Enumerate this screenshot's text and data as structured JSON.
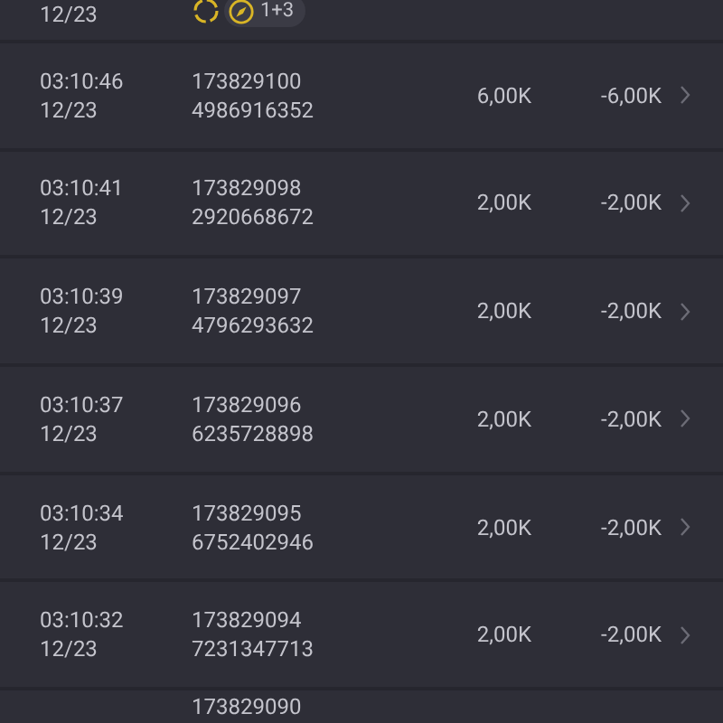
{
  "rows": [
    {
      "kind": "tail",
      "date": "12/23",
      "badge_count": "1+3"
    },
    {
      "kind": "full",
      "time": "03:10:46",
      "date": "12/23",
      "order": "173829100",
      "ref": "4986916352",
      "amount": "6,00K",
      "net": "-6,00K"
    },
    {
      "kind": "full",
      "time": "03:10:41",
      "date": "12/23",
      "order": "173829098",
      "ref": "2920668672",
      "amount": "2,00K",
      "net": "-2,00K"
    },
    {
      "kind": "full",
      "time": "03:10:39",
      "date": "12/23",
      "order": "173829097",
      "ref": "4796293632",
      "amount": "2,00K",
      "net": "-2,00K"
    },
    {
      "kind": "full",
      "time": "03:10:37",
      "date": "12/23",
      "order": "173829096",
      "ref": "6235728898",
      "amount": "2,00K",
      "net": "-2,00K"
    },
    {
      "kind": "full",
      "time": "03:10:34",
      "date": "12/23",
      "order": "173829095",
      "ref": "6752402946",
      "amount": "2,00K",
      "net": "-2,00K"
    },
    {
      "kind": "full",
      "time": "03:10:32",
      "date": "12/23",
      "order": "173829094",
      "ref": "7231347713",
      "amount": "2,00K",
      "net": "-2,00K"
    },
    {
      "kind": "head",
      "order": "173829090"
    }
  ]
}
